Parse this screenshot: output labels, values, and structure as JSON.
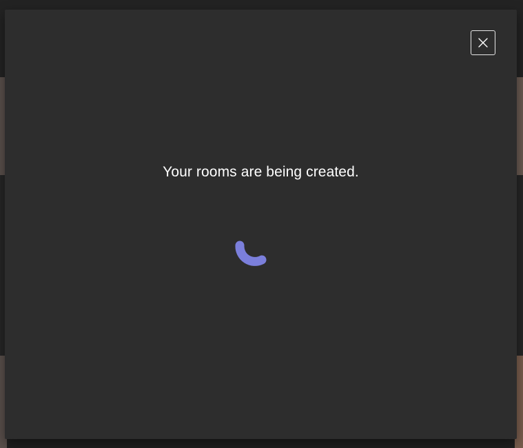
{
  "dialog": {
    "status_message": "Your rooms are being created.",
    "close_label": "Close"
  },
  "icons": {
    "close": "close-icon",
    "spinner": "loading-spinner-icon"
  },
  "colors": {
    "dialog_bg": "#2d2d2d",
    "text": "#ffffff",
    "spinner": "#7b7fdb"
  }
}
